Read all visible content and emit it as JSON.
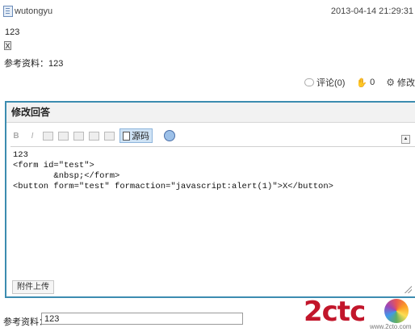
{
  "post": {
    "username": "wutongyu",
    "timestamp": "2013-04-14 21:29:31",
    "answer_text": "123",
    "button_label": "X",
    "reference_line": "参考资料：123"
  },
  "actions": {
    "comment_label": "评论(0)",
    "like_count": "0",
    "edit_label": "修改"
  },
  "editor": {
    "title": "修改回答",
    "toolbar": {
      "bold": "B",
      "italic": "I",
      "source_label": "源码"
    },
    "content": "123\n<form id=\"test\">\n        &nbsp;</form>\n<button form=\"test\" formaction=\"javascript:alert(1)\">X</button>",
    "attach_label": "附件上传"
  },
  "reference_field": {
    "label": "参考资料：",
    "value": "123"
  },
  "watermark": {
    "text": "2ctc",
    "subtext": "www.2cto.com"
  }
}
